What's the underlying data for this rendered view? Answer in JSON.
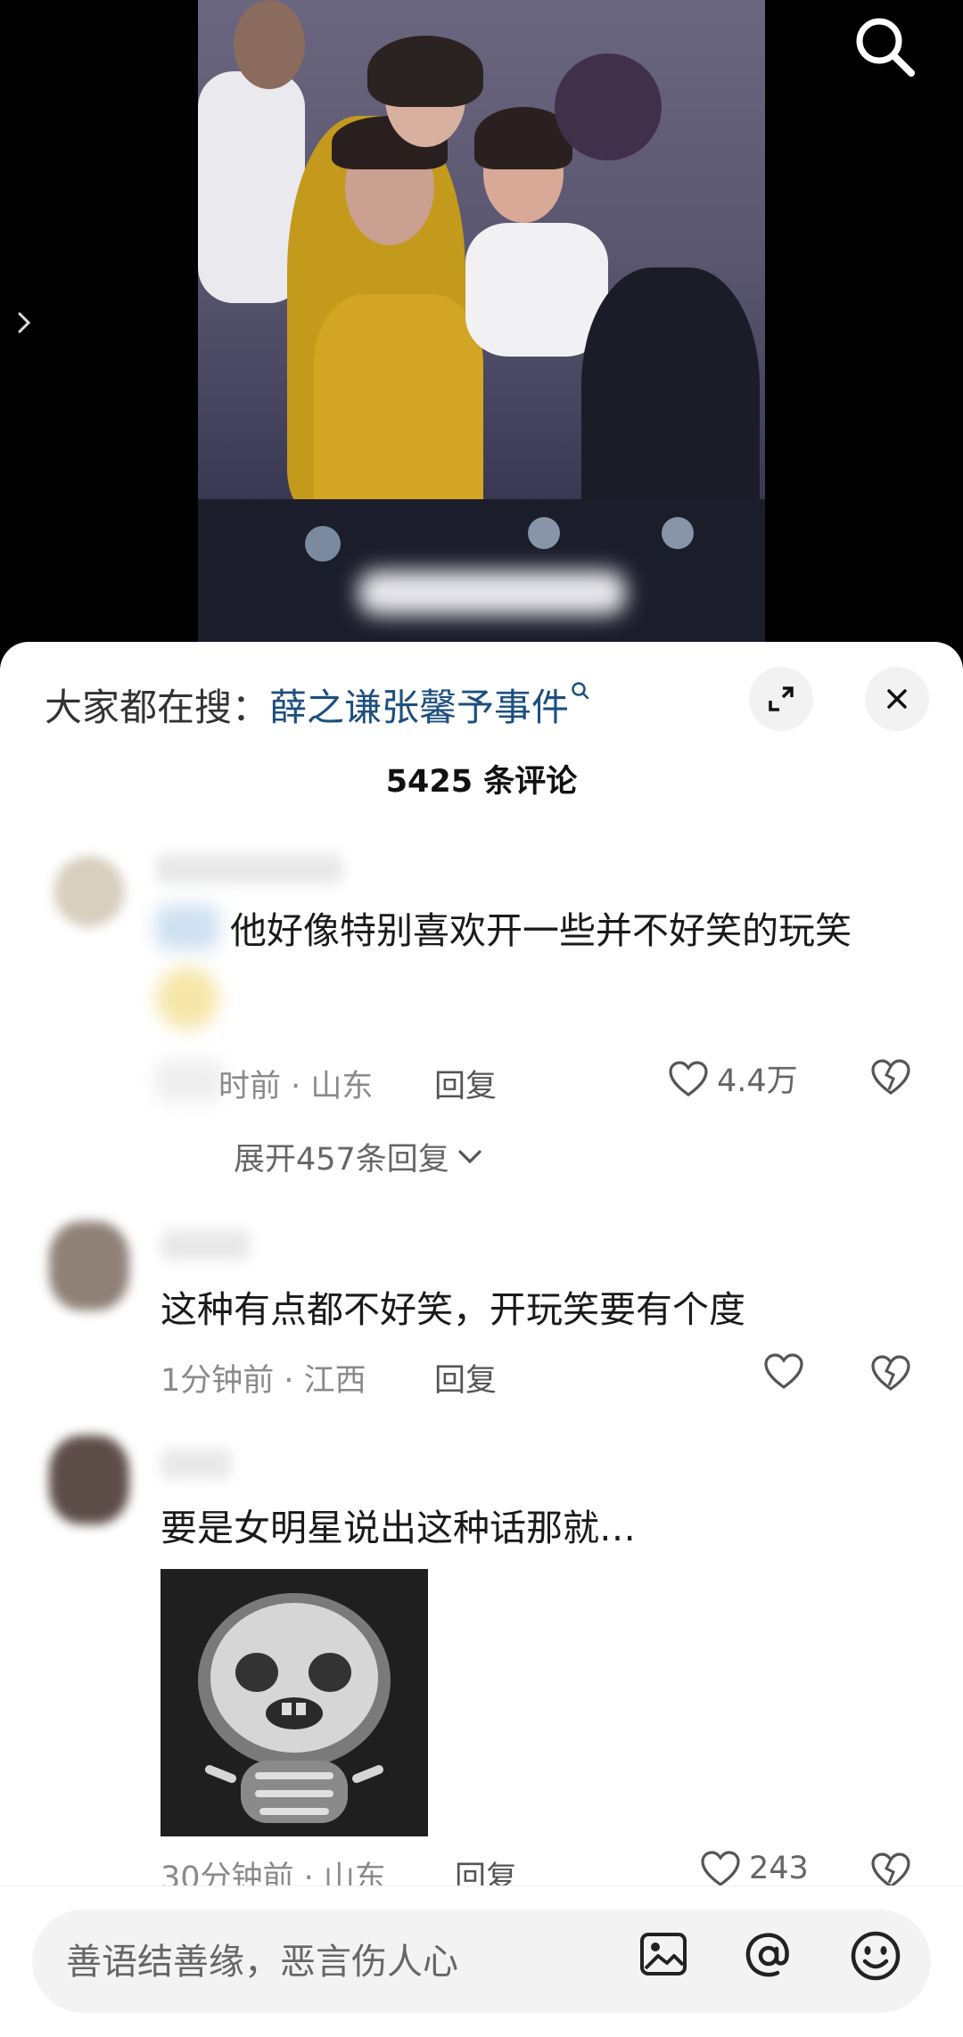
{
  "hot_search": {
    "prefix": "大家都在搜：",
    "term": "薛之谦张馨予事件"
  },
  "comment_count": "5425 条评论",
  "comments": [
    {
      "text": "他好像特别喜欢开一些并不好笑的玩笑",
      "time": "时前 · 山东",
      "reply": "回复",
      "likes": "4.4万",
      "expand": "展开457条回复"
    },
    {
      "text": "这种有点都不好笑，开玩笑要有个度",
      "time": "1分钟前 · 江西",
      "reply": "回复",
      "likes": ""
    },
    {
      "text": "要是女明星说出这种话那就…",
      "time": "30分钟前 · 山东",
      "reply": "回复",
      "likes": "243"
    }
  ],
  "input": {
    "placeholder": "善语结善缘，恶言伤人心"
  },
  "icons": [
    "search-icon",
    "chevron-right-icon",
    "fullscreen-icon",
    "close-icon",
    "heart-icon",
    "broken-heart-icon",
    "chevron-down-icon",
    "image-icon",
    "at-icon",
    "emoji-icon"
  ]
}
